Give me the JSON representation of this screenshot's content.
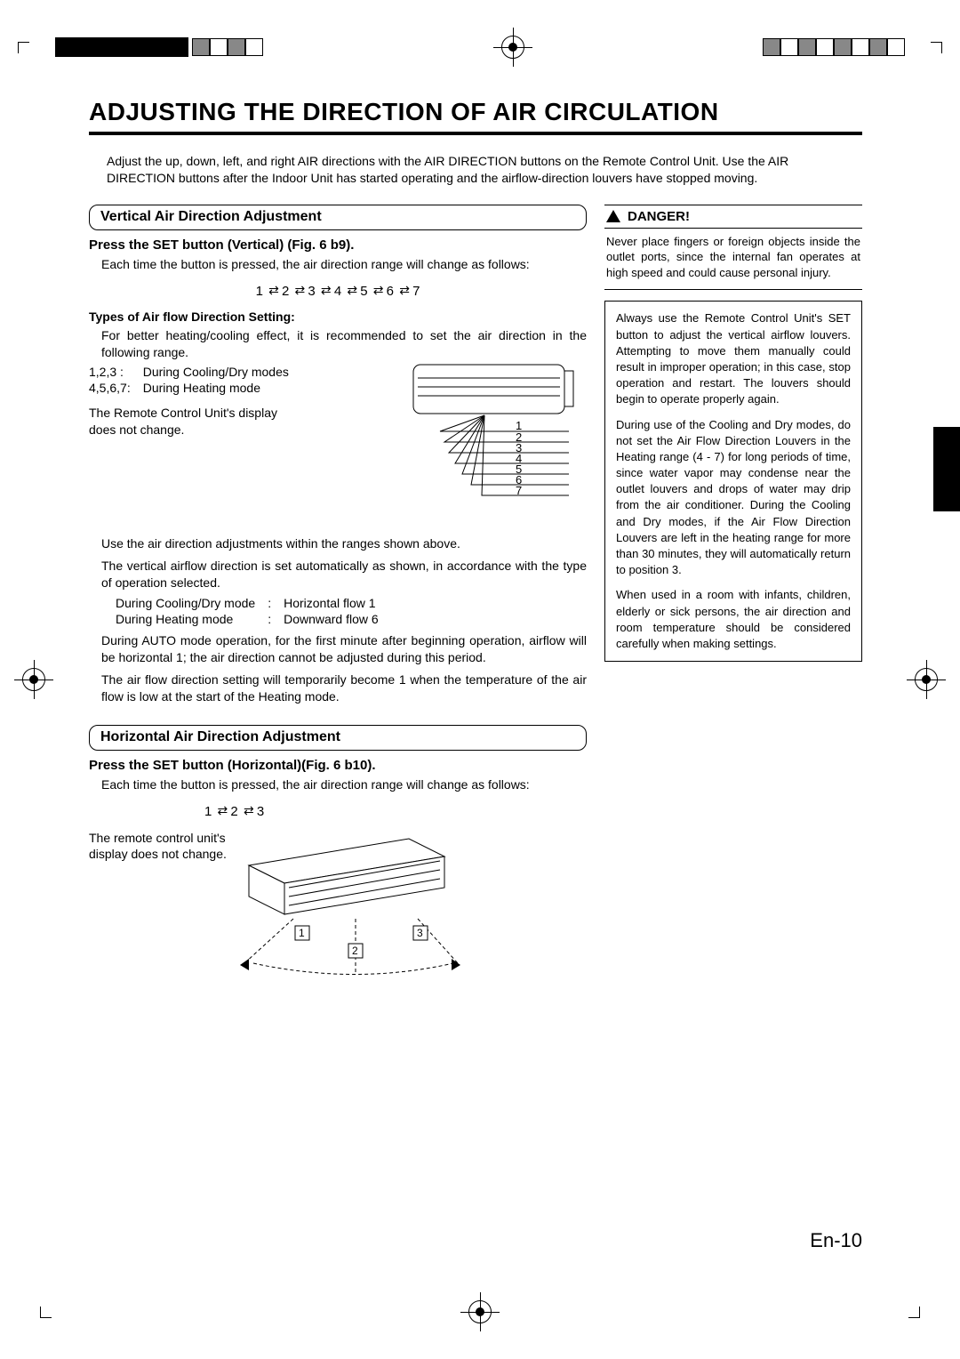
{
  "page_title": "ADJUSTING THE DIRECTION OF AIR CIRCULATION",
  "intro": "Adjust the up, down, left, and right AIR directions with the AIR DIRECTION buttons on the Remote Control Unit. Use the AIR DIRECTION buttons after the Indoor Unit has started operating and the airflow-direction louvers have stopped moving.",
  "vert": {
    "head": "Vertical Air Direction Adjustment",
    "press": "Press the SET button (Vertical) (Fig. 6 b9).",
    "each": "Each time the button is pressed, the air direction range will change as follows:",
    "types_head": "Types of Air flow Direction Setting:",
    "types_intro": "For better heating/cooling effect, it is recommended to set the air direction in the following range.",
    "rows": [
      {
        "k": "1,2,3 :",
        "v": "During Cooling/Dry modes"
      },
      {
        "k": "4,5,6,7:",
        "v": "During Heating mode"
      }
    ],
    "remote_note": "The Remote Control Unit's display does not change.",
    "below1": "Use the air direction adjustments within the ranges shown above.",
    "below2": "The vertical airflow direction is set automatically as shown, in accordance with the type of operation selected.",
    "mode_rows": [
      {
        "k": "During Cooling/Dry mode",
        "c": ":",
        "v": "Horizontal flow 1"
      },
      {
        "k": "During Heating mode",
        "c": ":",
        "v": "Downward flow 6"
      }
    ],
    "below3": "During AUTO mode operation, for the first minute after beginning operation, airflow will be horizontal 1; the air direction cannot be adjusted during this period.",
    "below4": "The air flow direction setting will temporarily become 1 when the temperature of the air flow is low at the start of the Heating mode."
  },
  "horiz": {
    "head": "Horizontal Air Direction Adjustment",
    "press": "Press the SET button (Horizontal)(Fig. 6 b10).",
    "each": "Each time the button is pressed, the air direction range will change as follows:",
    "remote_note": "The remote control unit's display does not change."
  },
  "danger": {
    "head": "DANGER!",
    "body": "Never place fingers or foreign objects inside the outlet ports, since the internal fan operates at high speed and could cause personal injury."
  },
  "caution": {
    "p1": "Always use the Remote Control Unit's SET button to adjust the vertical airflow louvers. Attempting to move them manually could result in improper operation; in this case, stop operation and restart. The louvers should begin to operate properly again.",
    "p2": "During use of the Cooling and Dry modes, do not set the Air Flow Direction Louvers in the Heating range (4 - 7) for long periods of time, since water vapor may condense near the outlet louvers and drops of water may drip from the air conditioner. During the Cooling and Dry modes, if the Air Flow Direction Louvers are left in the heating range for more than 30 minutes, they will automatically return to position 3.",
    "p3": "When used in a room with infants, children, elderly or sick persons, the air direction and room temperature should be considered carefully when making settings."
  },
  "seq7": [
    "1",
    "2",
    "3",
    "4",
    "5",
    "6",
    "7"
  ],
  "seq3": [
    "1",
    "2",
    "3"
  ],
  "fig_vert_labels": [
    "1",
    "2",
    "3",
    "4",
    "5",
    "6",
    "7"
  ],
  "fig_horiz_labels": [
    "1",
    "2",
    "3"
  ],
  "page_number": "En-10"
}
